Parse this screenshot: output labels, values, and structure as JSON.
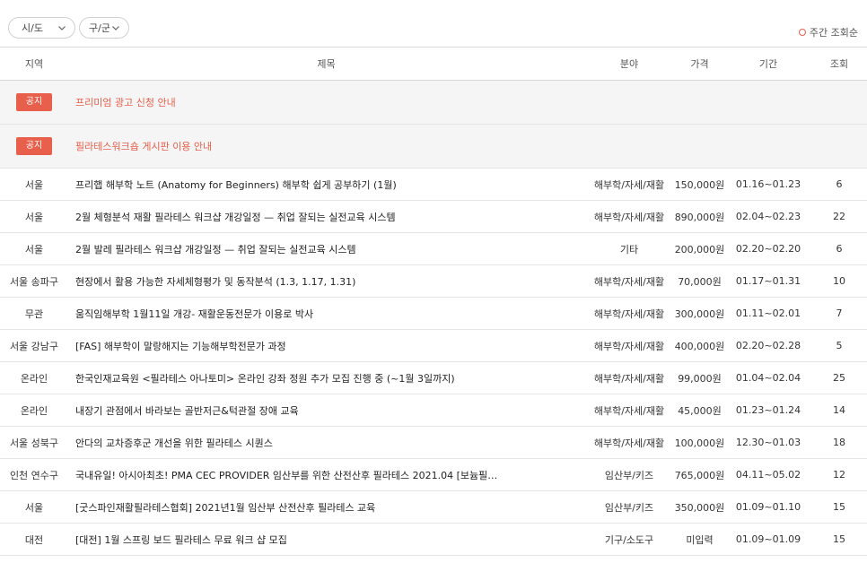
{
  "filters": {
    "city": {
      "label": "시/도"
    },
    "district": {
      "label": "구/군"
    },
    "sort_label": "주간 조회순"
  },
  "columns": [
    "지역",
    "제목",
    "분야",
    "가격",
    "기간",
    "조회"
  ],
  "notices": [
    {
      "badge": "공지",
      "title": "프리미엄 광고 신청 안내"
    },
    {
      "badge": "공지",
      "title": "필라테스워크숍 게시판 이용 안내"
    }
  ],
  "rows": [
    {
      "region": "서울",
      "title": "프리햅 해부학 노트 (Anatomy for Beginners) 해부학 쉽게 공부하기 (1월)",
      "field": "해부학/자세/재활",
      "price": "150,000원",
      "period": "01.16~01.23",
      "views": "6"
    },
    {
      "region": "서울",
      "title": "2월 체형분석 재활 필라테스 워크샵 개강일정 — 취업 잘되는 실전교육 시스템",
      "field": "해부학/자세/재활",
      "price": "890,000원",
      "period": "02.04~02.23",
      "views": "22"
    },
    {
      "region": "서울",
      "title": "2월 발레 필라테스 워크샵 개강일정 — 취업 잘되는 실전교육 시스템",
      "field": "기타",
      "price": "200,000원",
      "period": "02.20~02.20",
      "views": "6"
    },
    {
      "region": "서울 송파구",
      "title": "현장에서 활용 가능한 자세체형평가 및 동작분석 (1.3, 1.17, 1.31)",
      "field": "해부학/자세/재활",
      "price": "70,000원",
      "period": "01.17~01.31",
      "views": "10"
    },
    {
      "region": "무관",
      "title": "움직임해부학 1월11일 개강- 재활운동전문가 이용로 박사",
      "field": "해부학/자세/재활",
      "price": "300,000원",
      "period": "01.11~02.01",
      "views": "7"
    },
    {
      "region": "서울 강남구",
      "title": "[FAS] 해부학이 말랑해지는 기능해부학전문가 과정",
      "field": "해부학/자세/재활",
      "price": "400,000원",
      "period": "02.20~02.28",
      "views": "5"
    },
    {
      "region": "온라인",
      "title": "한국인재교육원 <필라테스 아나토미> 온라인 강좌 정원 추가 모집 진행 중 (~1월 3일까지)",
      "field": "해부학/자세/재활",
      "price": "99,000원",
      "period": "01.04~02.04",
      "views": "25"
    },
    {
      "region": "온라인",
      "title": "내장기 관점에서 바라보는 골반저근&턱관절 장애 교육",
      "field": "해부학/자세/재활",
      "price": "45,000원",
      "period": "01.23~01.24",
      "views": "14"
    },
    {
      "region": "서울 성북구",
      "title": "안다의 교차증후군 개선을 위한 필라테스 시퀀스",
      "field": "해부학/자세/재활",
      "price": "100,000원",
      "period": "12.30~01.03",
      "views": "18"
    },
    {
      "region": "인천 연수구",
      "title": "국내유일! 아시아최초! PMA CEC PROVIDER 임산부를 위한 산전산후 필라테스 2021.04 [보늄필…",
      "field": "임산부/키즈",
      "price": "765,000원",
      "period": "04.11~05.02",
      "views": "12"
    },
    {
      "region": "서울",
      "title": "[굿스파인재활필라테스협회] 2021년1월 임산부 산전산후 필라테스 교육",
      "field": "임산부/키즈",
      "price": "350,000원",
      "period": "01.09~01.10",
      "views": "15"
    },
    {
      "region": "대전",
      "title": "[대전] 1월 스프링 보드 필라테스 무료 워크 샵 모집",
      "field": "기구/소도구",
      "price": "미입력",
      "period": "01.09~01.09",
      "views": "15"
    }
  ]
}
